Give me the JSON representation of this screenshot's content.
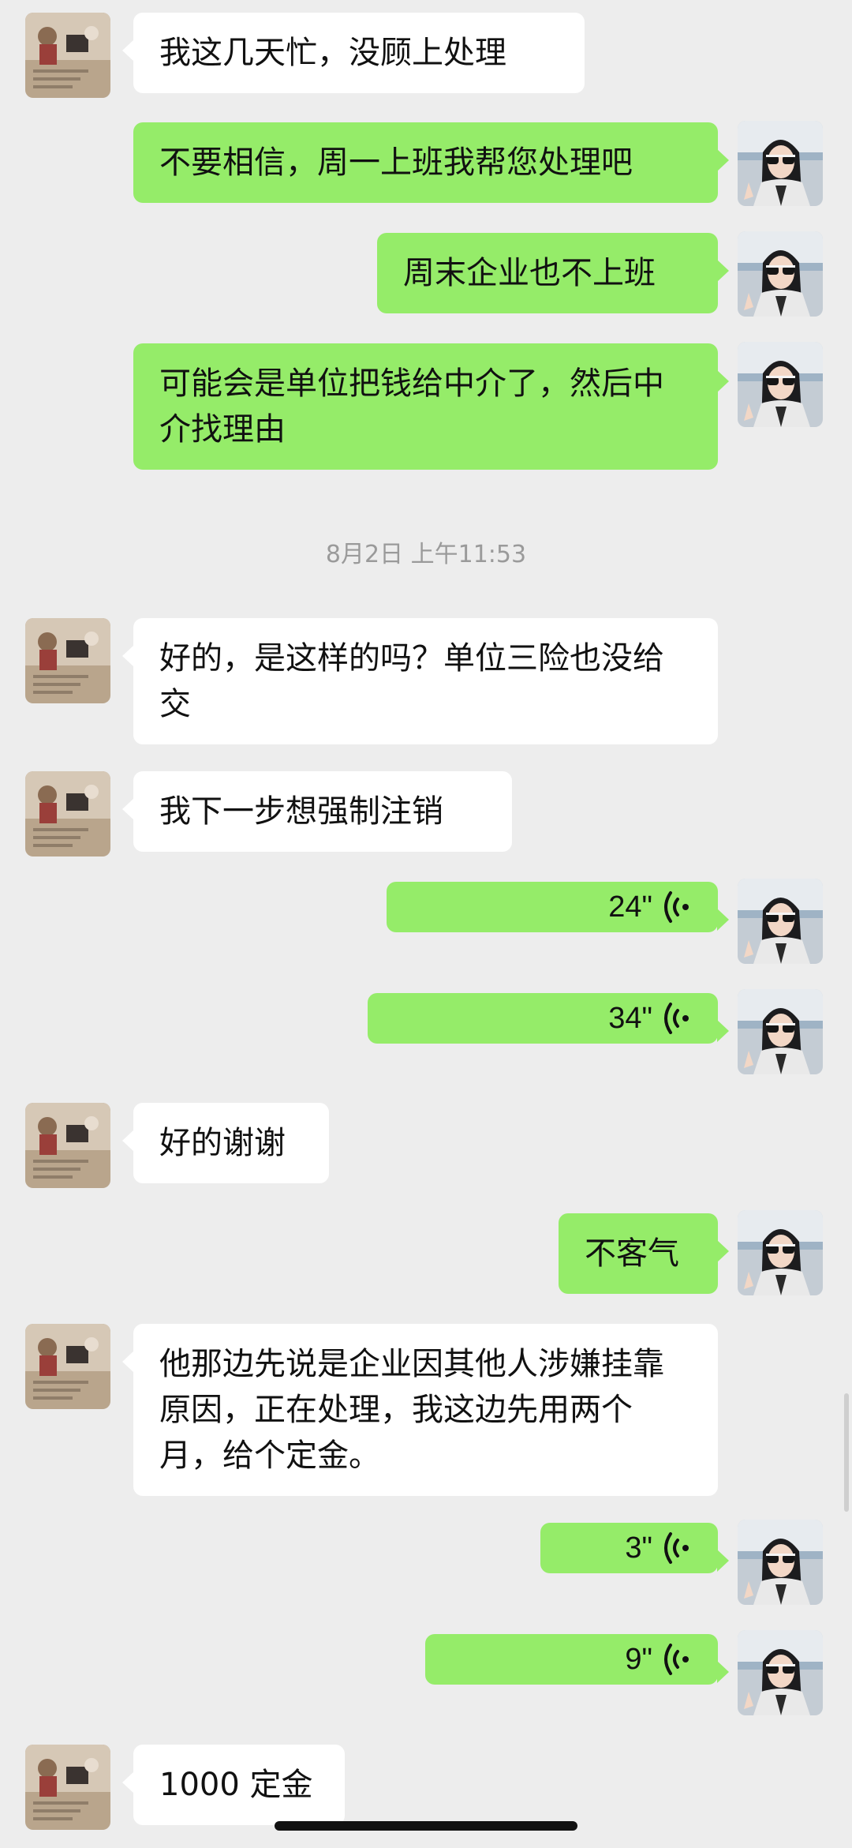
{
  "chat": {
    "messages": [
      {
        "side": "in",
        "type": "text",
        "text": "我这几天忙，没顾上处理"
      },
      {
        "side": "out",
        "type": "text",
        "text": "不要相信，周一上班我帮您处理吧"
      },
      {
        "side": "out",
        "type": "text",
        "text": "周末企业也不上班"
      },
      {
        "side": "out",
        "type": "text",
        "text": "可能会是单位把钱给中介了，然后中介找理由"
      },
      {
        "side": "in",
        "type": "text",
        "text": "好的，是这样的吗？单位三险也没给交"
      },
      {
        "side": "in",
        "type": "text",
        "text": "我下一步想强制注销"
      },
      {
        "side": "out",
        "type": "voice",
        "text": "24\""
      },
      {
        "side": "out",
        "type": "voice",
        "text": "34\""
      },
      {
        "side": "in",
        "type": "text",
        "text": "好的谢谢"
      },
      {
        "side": "out",
        "type": "text",
        "text": "不客气"
      },
      {
        "side": "in",
        "type": "text",
        "text": "他那边先说是企业因其他人涉嫌挂靠原因，正在处理，我这边先用两个月，给个定金。"
      },
      {
        "side": "out",
        "type": "voice",
        "text": "3\""
      },
      {
        "side": "out",
        "type": "voice",
        "text": "9\""
      },
      {
        "side": "in",
        "type": "text",
        "text": "1000 定金"
      }
    ],
    "timestamp": "8月2日 上午11:53"
  },
  "colors": {
    "background": "#ededed",
    "incoming_bubble": "#ffffff",
    "outgoing_bubble": "#95ec69",
    "timestamp_text": "#9a9a9a"
  },
  "icons": {
    "voice": "voice-wave-icon",
    "contact_avatar": "contact-avatar",
    "self_avatar": "self-avatar"
  }
}
